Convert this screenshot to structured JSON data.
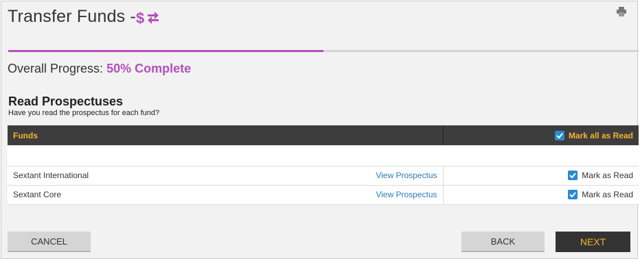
{
  "header": {
    "title": "Transfer Funds -",
    "title_icon": "dollar-transfer-icon",
    "print_icon": "printer-icon"
  },
  "progress": {
    "label": "Overall Progress:",
    "value_text": "50% Complete",
    "fraction": 0.5
  },
  "section": {
    "title": "Read Prospectuses",
    "subtitle": "Have you read the prospectus for each fund?"
  },
  "table": {
    "header_funds": "Funds",
    "header_mark_all": "Mark all as Read",
    "rows": [
      {
        "fund": "Sextant International",
        "link": "View Prospectus",
        "mark": "Mark as Read",
        "checked": true
      },
      {
        "fund": "Sextant Core",
        "link": "View Prospectus",
        "mark": "Mark as Read",
        "checked": true
      }
    ]
  },
  "buttons": {
    "cancel": "CANCEL",
    "back": "BACK",
    "next": "NEXT"
  },
  "colors": {
    "accent": "#b54fbc",
    "header_bg": "#3d3d3d",
    "header_text": "#f2b530",
    "link": "#2a7bb8",
    "checkbox": "#2a8ad0"
  }
}
